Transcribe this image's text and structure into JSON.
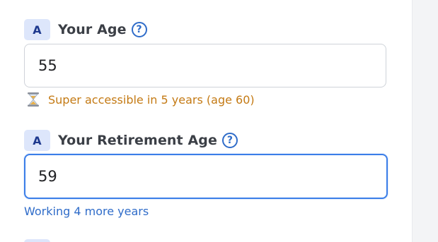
{
  "fields": [
    {
      "badge": "A",
      "label": "Your Age",
      "help": "?",
      "value": "55",
      "hint": "Super accessible in 5 years (age 60)",
      "hint_icon": "hourglass-icon",
      "hint_color": "#c47a14"
    },
    {
      "badge": "A",
      "label": "Your Retirement Age",
      "help": "?",
      "value": "59",
      "hint": "Working 4 more years",
      "hint_color": "#2f6cc9"
    }
  ],
  "colors": {
    "accent": "#3b7ee8",
    "badge_bg": "#dde6fb",
    "badge_text": "#1f3a8f",
    "label_text": "#3b3f46",
    "warn": "#c47a14",
    "info": "#2f6cc9"
  }
}
